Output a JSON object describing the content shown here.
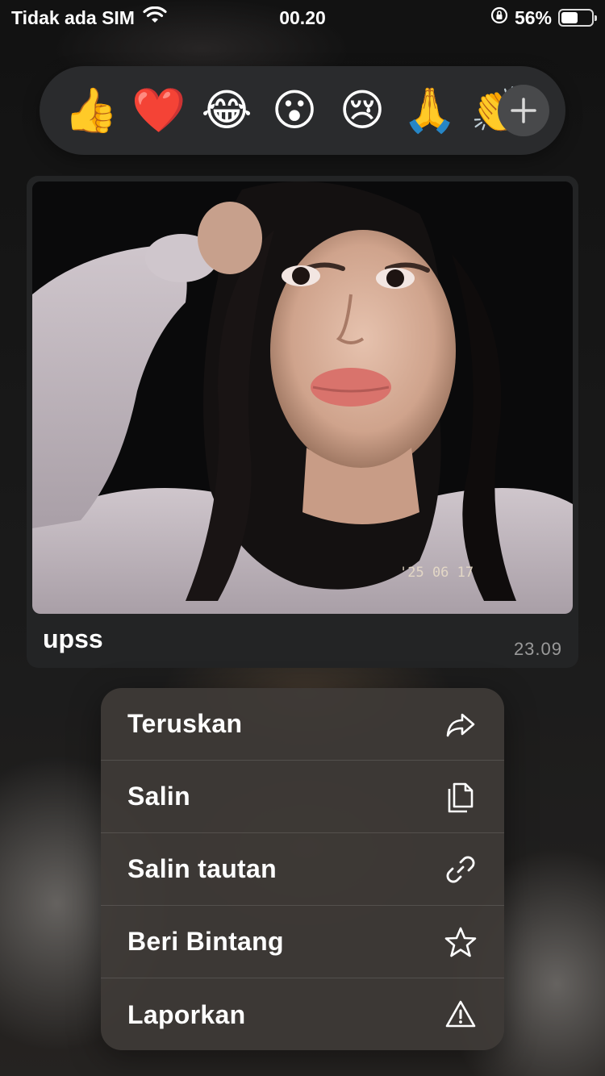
{
  "status_bar": {
    "carrier": "Tidak ada SIM",
    "time": "00.20",
    "battery_percent": "56%",
    "battery_level": 0.56
  },
  "reactions": [
    {
      "emoji": "👍",
      "name": "thumbs-up"
    },
    {
      "emoji": "❤️",
      "name": "red-heart"
    },
    {
      "emoji": "😂",
      "name": "tears-of-joy"
    },
    {
      "emoji": "😮",
      "name": "surprised"
    },
    {
      "emoji": "😢",
      "name": "crying"
    },
    {
      "emoji": "🙏",
      "name": "folded-hands"
    },
    {
      "emoji": "👏",
      "name": "clapping-hands"
    }
  ],
  "message": {
    "photo_stamp": "'25 06 17",
    "caption": "upss",
    "time": "23.09"
  },
  "menu": {
    "items": [
      {
        "label": "Teruskan",
        "icon": "forward-icon"
      },
      {
        "label": "Salin",
        "icon": "copy-icon"
      },
      {
        "label": "Salin tautan",
        "icon": "link-icon"
      },
      {
        "label": "Beri Bintang",
        "icon": "star-icon"
      },
      {
        "label": "Laporkan",
        "icon": "warning-icon"
      }
    ]
  }
}
